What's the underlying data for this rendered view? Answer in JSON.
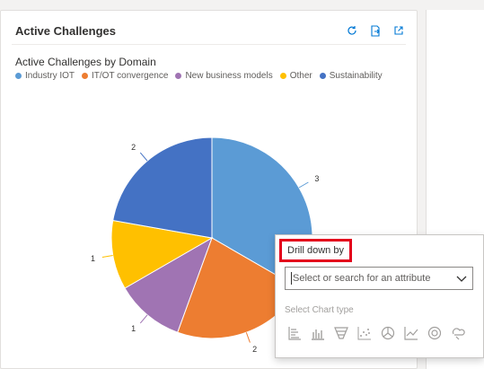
{
  "panel": {
    "title": "Active Challenges",
    "actions": [
      "refresh-icon",
      "export-icon",
      "expand-icon"
    ]
  },
  "chart_data": {
    "type": "pie",
    "title": "Active Challenges by Domain",
    "categories": [
      "Industry IOT",
      "IT/OT convergence",
      "New business models",
      "Other",
      "Sustainability"
    ],
    "values": [
      3,
      2,
      1,
      1,
      2
    ],
    "colors": [
      "#5b9bd5",
      "#ed7d31",
      "#a074b3",
      "#ffc000",
      "#4472c4"
    ],
    "legend_position": "top-left",
    "data_labels": [
      "3",
      "2",
      "1",
      "1",
      "2"
    ]
  },
  "drilldown": {
    "label": "Drill down by",
    "placeholder": "Select or search for an attribute",
    "chart_type_label": "Select Chart type",
    "chart_types": [
      "bar-chart-icon",
      "column-chart-icon",
      "funnel-chart-icon",
      "scatter-chart-icon",
      "pie-chart-icon",
      "line-chart-icon",
      "donut-chart-icon",
      "tag-chart-icon"
    ],
    "highlight_color": "#e3001b"
  }
}
